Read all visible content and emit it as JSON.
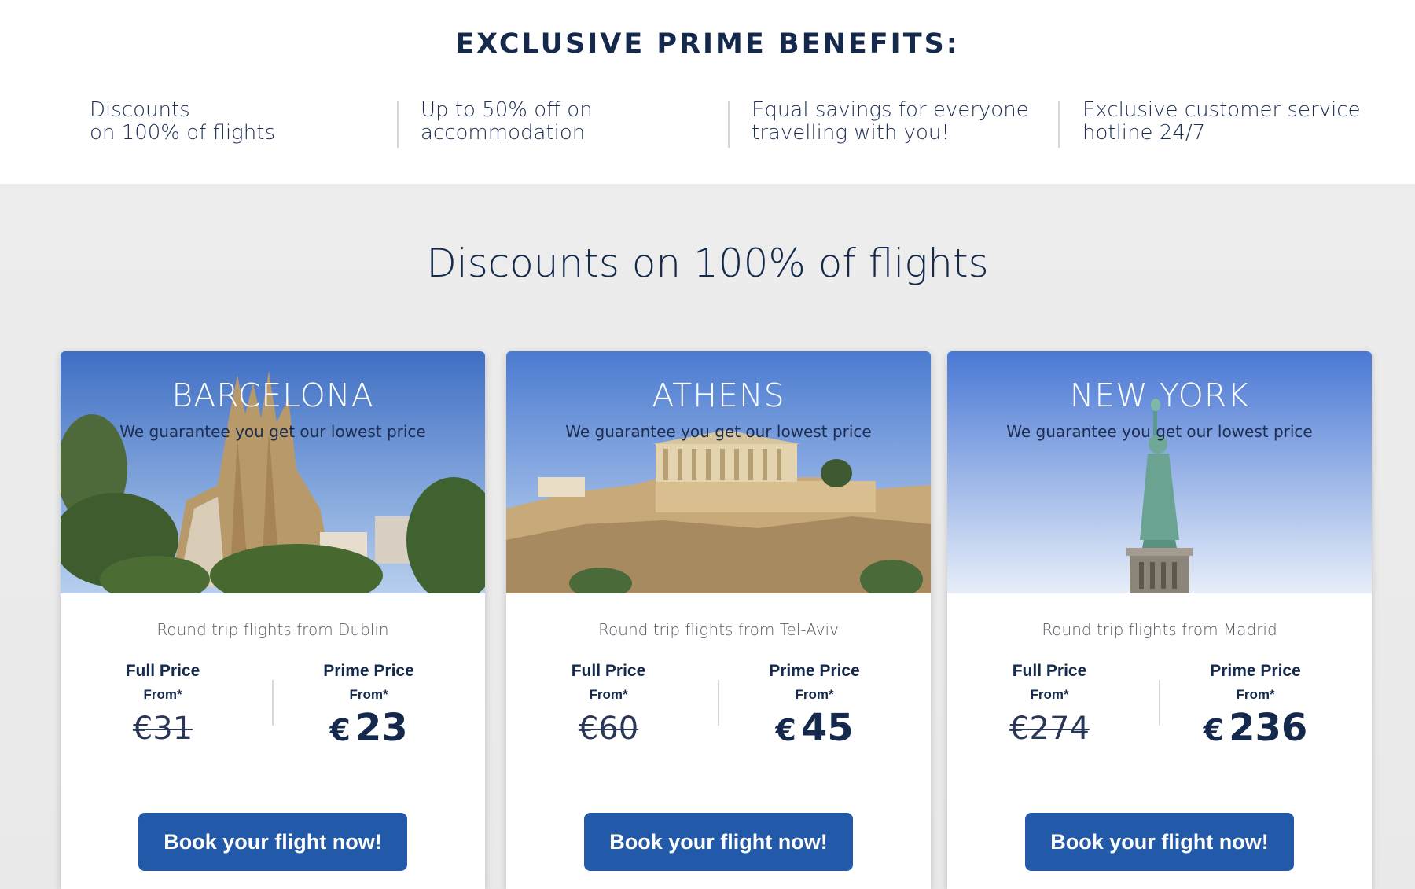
{
  "benefits": {
    "title": "EXCLUSIVE PRIME BENEFITS:",
    "items": [
      {
        "line1": "Discounts",
        "line2": "on 100% of flights"
      },
      {
        "line1": "Up to 50% off on",
        "line2": "accommodation"
      },
      {
        "line1": "Equal savings for everyone",
        "line2": "travelling with you!"
      },
      {
        "line1": "Exclusive customer service",
        "line2": "hotline 24/7"
      }
    ]
  },
  "offers": {
    "title": "Discounts on 100% of flights",
    "cards": [
      {
        "city": "BARCELONA",
        "guarantee": "We guarantee you get our lowest price",
        "route": "Round trip flights from Dublin",
        "full_label": "Full Price",
        "full_from": "From*",
        "full_price": "€31",
        "prime_label": "Prime Price",
        "prime_from": "From*",
        "prime_currency": "€",
        "prime_price": "23",
        "button": "Book your flight now!"
      },
      {
        "city": "ATHENS",
        "guarantee": "We guarantee you get our lowest price",
        "route": "Round trip flights from Tel-Aviv",
        "full_label": "Full Price",
        "full_from": "From*",
        "full_price": "€60",
        "prime_label": "Prime Price",
        "prime_from": "From*",
        "prime_currency": "€",
        "prime_price": "45",
        "button": "Book your flight now!"
      },
      {
        "city": "NEW YORK",
        "guarantee": "We guarantee you get our lowest price",
        "route": "Round trip flights from Madrid",
        "full_label": "Full Price",
        "full_from": "From*",
        "full_price": "€274",
        "prime_label": "Prime Price",
        "prime_from": "From*",
        "prime_currency": "€",
        "prime_price": "236",
        "button": "Book your flight now!"
      }
    ]
  },
  "colors": {
    "navy": "#14294b",
    "button": "#2259a8",
    "section_bg": "#ededed",
    "sky": "#5b8ad6"
  }
}
